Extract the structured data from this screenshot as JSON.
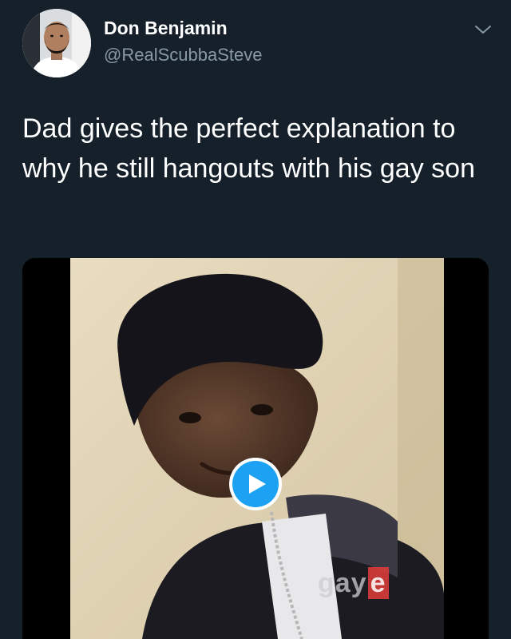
{
  "author": {
    "display_name": "Don Benjamin",
    "handle": "@RealScubbaSteve",
    "avatar_icon": "avatar-photo"
  },
  "header": {
    "menu_icon": "chevron-down-icon"
  },
  "tweet": {
    "text": "Dad gives the perfect explanation to why he still hangouts with his gay son"
  },
  "media": {
    "type": "video",
    "play_icon": "play-icon",
    "watermark_main": "gay",
    "watermark_last": "e",
    "colors": {
      "play_button": "#1da1f2",
      "background": "#15202b",
      "secondary_text": "#8899a6"
    }
  }
}
